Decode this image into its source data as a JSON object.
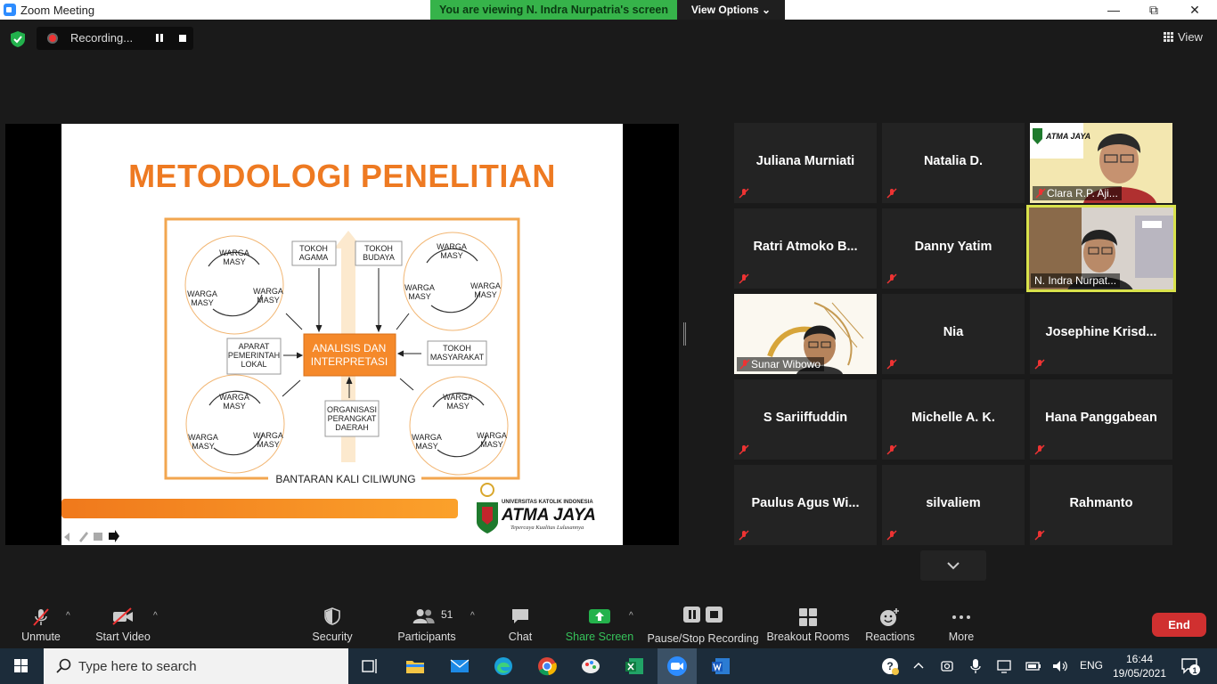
{
  "window": {
    "title": "Zoom Meeting",
    "banner": "You are viewing N. Indra Nurpatria's screen",
    "view_options": "View Options",
    "view_options_chevron": "⌄",
    "minimize": "—",
    "maximize": "⧉",
    "close": "✕"
  },
  "meeting": {
    "recording_label": "Recording...",
    "view_label": "View"
  },
  "slide": {
    "title": "METODOLOGI PENELITIAN",
    "center_box": [
      "ANALISIS DAN",
      "INTERPRETASI"
    ],
    "warga_masy": [
      "WARGA",
      "MASY"
    ],
    "tokoh_agama": [
      "TOKOH",
      "AGAMA"
    ],
    "tokoh_budaya": [
      "TOKOH",
      "BUDAYA"
    ],
    "aparat": [
      "APARAT",
      "PEMERINTAH",
      "LOKAL"
    ],
    "tokoh_masyarakat": [
      "TOKOH",
      "MASYARAKAT"
    ],
    "organisasi": [
      "ORGANISASI",
      "PERANGKAT",
      "DAERAH"
    ],
    "footer": "BANTARAN KALI CILIWUNG",
    "logo_university": "UNIVERSITAS KATOLIK INDONESIA",
    "logo_name": "ATMA JAYA",
    "logo_tagline": "Tepercaya Kualitas Lulusannya"
  },
  "gallery": {
    "participants": [
      {
        "name": "Juliana Murniati",
        "video": false
      },
      {
        "name": "Natalia D.",
        "video": false
      },
      {
        "name": "Clara R.P. Aji...",
        "video": true
      },
      {
        "name": "Ratri Atmoko B...",
        "video": false
      },
      {
        "name": "Danny Yatim",
        "video": false
      },
      {
        "name": "N. Indra Nurpat...",
        "video": true
      },
      {
        "name": "Sunar Wibowo",
        "video": true
      },
      {
        "name": "Nia",
        "video": false
      },
      {
        "name": "Josephine  Krisd...",
        "video": false
      },
      {
        "name": "S Sariiffuddin",
        "video": false
      },
      {
        "name": "Michelle A. K.",
        "video": false
      },
      {
        "name": "Hana Panggabean",
        "video": false
      },
      {
        "name": "Paulus  Agus  Wi...",
        "video": false
      },
      {
        "name": "silvaliem",
        "video": false
      },
      {
        "name": "Rahmanto",
        "video": false
      }
    ]
  },
  "toolbar": {
    "unmute": "Unmute",
    "start_video": "Start Video",
    "security": "Security",
    "participants": "Participants",
    "participants_count": "51",
    "chat": "Chat",
    "share_screen": "Share Screen",
    "pause_stop_recording": "Pause/Stop Recording",
    "breakout_rooms": "Breakout Rooms",
    "reactions": "Reactions",
    "more": "More",
    "end": "End"
  },
  "taskbar": {
    "search_placeholder": "Type here to search",
    "language": "ENG",
    "time": "16:44",
    "date": "19/05/2021",
    "notification_count": "1"
  },
  "colors": {
    "accent_green": "#36b34a",
    "slide_orange": "#ee7a22",
    "end_red": "#d03030",
    "active_speaker": "#d9e24b"
  }
}
